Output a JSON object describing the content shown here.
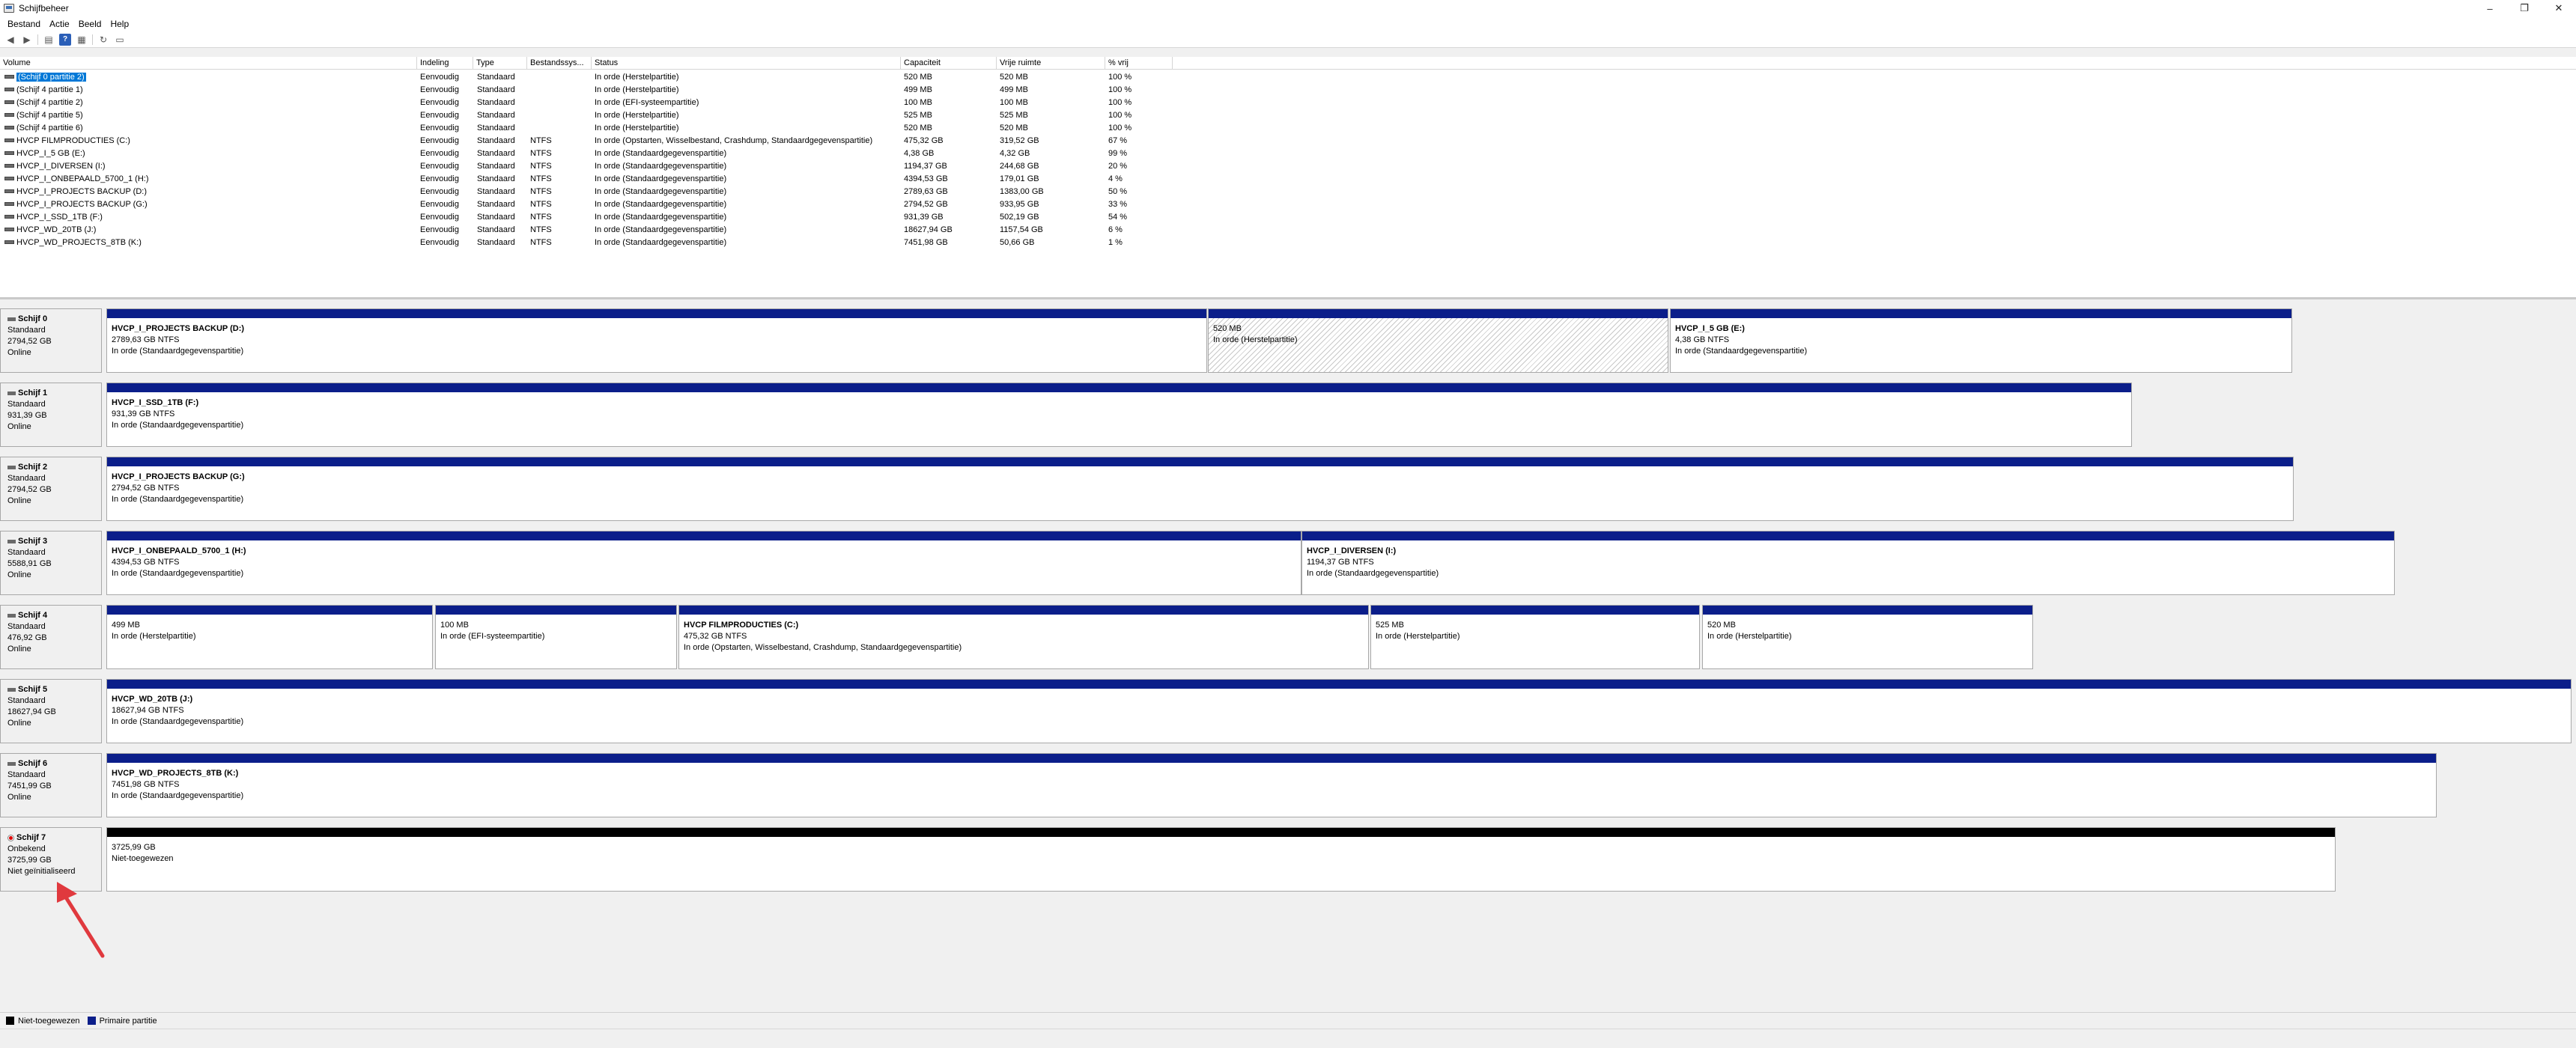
{
  "window": {
    "title": "Schijfbeheer",
    "minimize": "–",
    "restore": "❐",
    "close": "✕"
  },
  "menu": [
    "Bestand",
    "Actie",
    "Beeld",
    "Help"
  ],
  "toolbar": [
    "back-icon",
    "forward-icon",
    "list-icon",
    "help-icon",
    "properties-icon",
    "refresh-icon",
    "settings-icon"
  ],
  "columns": [
    "Volume",
    "Indeling",
    "Type",
    "Bestandssys...",
    "Status",
    "Capaciteit",
    "Vrije ruimte",
    "% vrij"
  ],
  "volumes": [
    {
      "name": "(Schijf 0 partitie 2)",
      "layout": "Eenvoudig",
      "type": "Standaard",
      "fs": "",
      "status": "In orde (Herstelpartitie)",
      "capacity": "520 MB",
      "free": "520 MB",
      "pct": "100 %"
    },
    {
      "name": "(Schijf 4 partitie 1)",
      "layout": "Eenvoudig",
      "type": "Standaard",
      "fs": "",
      "status": "In orde (Herstelpartitie)",
      "capacity": "499 MB",
      "free": "499 MB",
      "pct": "100 %"
    },
    {
      "name": "(Schijf 4 partitie 2)",
      "layout": "Eenvoudig",
      "type": "Standaard",
      "fs": "",
      "status": "In orde (EFI-systeempartitie)",
      "capacity": "100 MB",
      "free": "100 MB",
      "pct": "100 %"
    },
    {
      "name": "(Schijf 4 partitie 5)",
      "layout": "Eenvoudig",
      "type": "Standaard",
      "fs": "",
      "status": "In orde (Herstelpartitie)",
      "capacity": "525 MB",
      "free": "525 MB",
      "pct": "100 %"
    },
    {
      "name": "(Schijf 4 partitie 6)",
      "layout": "Eenvoudig",
      "type": "Standaard",
      "fs": "",
      "status": "In orde (Herstelpartitie)",
      "capacity": "520 MB",
      "free": "520 MB",
      "pct": "100 %"
    },
    {
      "name": "HVCP FILMPRODUCTIES (C:)",
      "layout": "Eenvoudig",
      "type": "Standaard",
      "fs": "NTFS",
      "status": "In orde (Opstarten, Wisselbestand, Crashdump, Standaardgegevenspartitie)",
      "capacity": "475,32 GB",
      "free": "319,52 GB",
      "pct": "67 %"
    },
    {
      "name": "HVCP_I_5 GB (E:)",
      "layout": "Eenvoudig",
      "type": "Standaard",
      "fs": "NTFS",
      "status": "In orde (Standaardgegevenspartitie)",
      "capacity": "4,38 GB",
      "free": "4,32 GB",
      "pct": "99 %"
    },
    {
      "name": "HVCP_I_DIVERSEN (I:)",
      "layout": "Eenvoudig",
      "type": "Standaard",
      "fs": "NTFS",
      "status": "In orde (Standaardgegevenspartitie)",
      "capacity": "1194,37 GB",
      "free": "244,68 GB",
      "pct": "20 %"
    },
    {
      "name": "HVCP_I_ONBEPAALD_5700_1 (H:)",
      "layout": "Eenvoudig",
      "type": "Standaard",
      "fs": "NTFS",
      "status": "In orde (Standaardgegevenspartitie)",
      "capacity": "4394,53 GB",
      "free": "179,01 GB",
      "pct": "4 %"
    },
    {
      "name": "HVCP_I_PROJECTS BACKUP (D:)",
      "layout": "Eenvoudig",
      "type": "Standaard",
      "fs": "NTFS",
      "status": "In orde (Standaardgegevenspartitie)",
      "capacity": "2789,63 GB",
      "free": "1383,00 GB",
      "pct": "50 %"
    },
    {
      "name": "HVCP_I_PROJECTS BACKUP (G:)",
      "layout": "Eenvoudig",
      "type": "Standaard",
      "fs": "NTFS",
      "status": "In orde (Standaardgegevenspartitie)",
      "capacity": "2794,52 GB",
      "free": "933,95 GB",
      "pct": "33 %"
    },
    {
      "name": "HVCP_I_SSD_1TB (F:)",
      "layout": "Eenvoudig",
      "type": "Standaard",
      "fs": "NTFS",
      "status": "In orde (Standaardgegevenspartitie)",
      "capacity": "931,39 GB",
      "free": "502,19 GB",
      "pct": "54 %"
    },
    {
      "name": "HVCP_WD_20TB (J:)",
      "layout": "Eenvoudig",
      "type": "Standaard",
      "fs": "NTFS",
      "status": "In orde (Standaardgegevenspartitie)",
      "capacity": "18627,94 GB",
      "free": "1157,54 GB",
      "pct": "6 %"
    },
    {
      "name": "HVCP_WD_PROJECTS_8TB (K:)",
      "layout": "Eenvoudig",
      "type": "Standaard",
      "fs": "NTFS",
      "status": "In orde (Standaardgegevenspartitie)",
      "capacity": "7451,98 GB",
      "free": "50,66 GB",
      "pct": "1 %"
    }
  ],
  "disks": [
    {
      "name": "Schijf 0",
      "kind": "Standaard",
      "size": "2794,52 GB",
      "state": "Online",
      "warn": false,
      "partitions": [
        {
          "name": "HVCP_I_PROJECTS BACKUP  (D:)",
          "size": "2789,63 GB NTFS",
          "status": "In orde (Standaardgegevenspartitie)",
          "style": "primary"
        },
        {
          "name": "",
          "size": "520 MB",
          "status": "In orde (Herstelpartitie)",
          "style": "hatched"
        },
        {
          "name": "HVCP_I_5 GB  (E:)",
          "size": "4,38 GB NTFS",
          "status": "In orde (Standaardgegevenspartitie)",
          "style": "primary"
        }
      ]
    },
    {
      "name": "Schijf 1",
      "kind": "Standaard",
      "size": "931,39 GB",
      "state": "Online",
      "warn": false,
      "partitions": [
        {
          "name": "HVCP_I_SSD_1TB  (F:)",
          "size": "931,39 GB NTFS",
          "status": "In orde (Standaardgegevenspartitie)",
          "style": "primary"
        }
      ]
    },
    {
      "name": "Schijf 2",
      "kind": "Standaard",
      "size": "2794,52 GB",
      "state": "Online",
      "warn": false,
      "partitions": [
        {
          "name": "HVCP_I_PROJECTS BACKUP  (G:)",
          "size": "2794,52 GB NTFS",
          "status": "In orde (Standaardgegevenspartitie)",
          "style": "primary"
        }
      ]
    },
    {
      "name": "Schijf 3",
      "kind": "Standaard",
      "size": "5588,91 GB",
      "state": "Online",
      "warn": false,
      "partitions": [
        {
          "name": "HVCP_I_ONBEPAALD_5700_1  (H:)",
          "size": "4394,53 GB NTFS",
          "status": "In orde (Standaardgegevenspartitie)",
          "style": "primary"
        },
        {
          "name": "HVCP_I_DIVERSEN  (I:)",
          "size": "1194,37 GB NTFS",
          "status": "In orde (Standaardgegevenspartitie)",
          "style": "primary"
        }
      ]
    },
    {
      "name": "Schijf 4",
      "kind": "Standaard",
      "size": "476,92 GB",
      "state": "Online",
      "warn": false,
      "partitions": [
        {
          "name": "",
          "size": "499 MB",
          "status": "In orde (Herstelpartitie)",
          "style": "primary"
        },
        {
          "name": "",
          "size": "100 MB",
          "status": "In orde (EFI-systeempartitie)",
          "style": "primary"
        },
        {
          "name": "HVCP FILMPRODUCTIES  (C:)",
          "size": "475,32 GB NTFS",
          "status": "In orde (Opstarten, Wisselbestand, Crashdump, Standaardgegevenspartitie)",
          "style": "primary"
        },
        {
          "name": "",
          "size": "525 MB",
          "status": "In orde (Herstelpartitie)",
          "style": "primary"
        },
        {
          "name": "",
          "size": "520 MB",
          "status": "In orde (Herstelpartitie)",
          "style": "primary"
        }
      ]
    },
    {
      "name": "Schijf 5",
      "kind": "Standaard",
      "size": "18627,94 GB",
      "state": "Online",
      "warn": false,
      "partitions": [
        {
          "name": "HVCP_WD_20TB  (J:)",
          "size": "18627,94 GB NTFS",
          "status": "In orde (Standaardgegevenspartitie)",
          "style": "primary"
        }
      ]
    },
    {
      "name": "Schijf 6",
      "kind": "Standaard",
      "size": "7451,99 GB",
      "state": "Online",
      "warn": false,
      "partitions": [
        {
          "name": "HVCP_WD_PROJECTS_8TB  (K:)",
          "size": "7451,98 GB NTFS",
          "status": "In orde (Standaardgegevenspartitie)",
          "style": "primary"
        }
      ]
    },
    {
      "name": "Schijf 7",
      "kind": "Onbekend",
      "size": "3725,99 GB",
      "state": "Niet geïnitialiseerd",
      "warn": true,
      "partitions": [
        {
          "name": "",
          "size": "3725,99 GB",
          "status": "Niet-toegewezen",
          "style": "unallocated"
        }
      ]
    }
  ],
  "legend": [
    {
      "label": "Niet-toegewezen",
      "color": "#000000"
    },
    {
      "label": "Primaire partitie",
      "color": "#0b1e8a"
    }
  ],
  "annotation": {
    "color": "#e0393e"
  }
}
